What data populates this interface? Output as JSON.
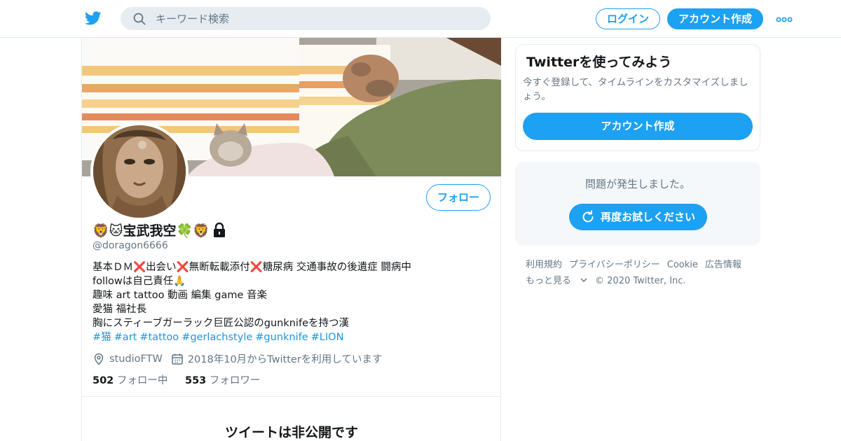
{
  "header": {
    "search_placeholder": "キーワード検索",
    "login_label": "ログイン",
    "signup_label": "アカウント作成"
  },
  "profile": {
    "name": "🦁🐱宝武我空🍀🦁",
    "handle": "@doragon6666",
    "follow_label": "フォロー",
    "bio": {
      "line1": [
        "基本ＤＭ",
        "❌",
        "出会い",
        "❌",
        "無断転載添付",
        "❌",
        "糖尿病 交通事故の後遺症 闘病中"
      ],
      "line2": "followは自己責任🙏",
      "line3": "趣味 art tattoo 動画 編集 game 音楽",
      "line4": "愛猫 福社長",
      "line5": "胸にスティーブガーラック巨匠公認のgunknifeを持つ漢",
      "hashtags": [
        "#猫",
        "#art",
        "#tattoo",
        "#gerlachstyle",
        "#gunknife",
        "#LION"
      ]
    },
    "location": "studioFTW",
    "joined": "2018年10月からTwitterを利用しています",
    "following_count": "502",
    "following_label": "フォロー中",
    "followers_count": "553",
    "followers_label": "フォロワー",
    "protected_title": "ツイートは非公開です"
  },
  "sidebar": {
    "promo_title": "Twitterを使ってみよう",
    "promo_desc": "今すぐ登録して、タイムラインをカスタマイズしましょう。",
    "promo_button": "アカウント作成",
    "error_text": "問題が発生しました。",
    "retry_label": "再度お試しください",
    "footer": {
      "links": [
        "利用規約",
        "プライバシーポリシー",
        "Cookie",
        "広告情報",
        "もっと見る"
      ],
      "copyright": "© 2020 Twitter, Inc."
    }
  },
  "colors": {
    "accent": "#1da1f2",
    "text_secondary": "#657786",
    "hashtag": "#1b95e0"
  },
  "icons": [
    "twitter-logo-icon",
    "search-icon",
    "more-dots-icon",
    "lock-icon",
    "location-icon",
    "calendar-icon",
    "refresh-icon",
    "chevron-down-icon"
  ]
}
